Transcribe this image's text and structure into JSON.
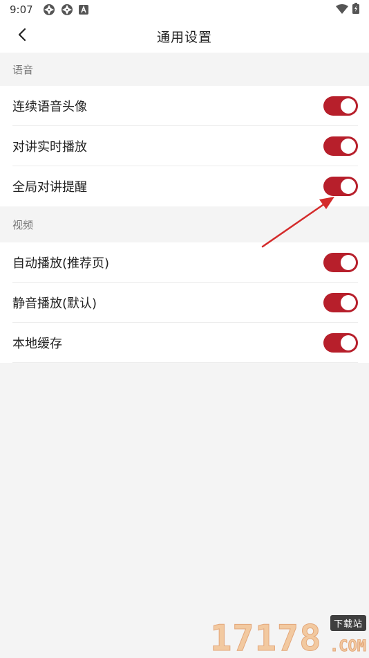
{
  "status_bar": {
    "time": "9:07",
    "icons_left": [
      "aperture-icon",
      "aperture-icon",
      "a-box-icon"
    ],
    "icons_right": [
      "wifi-icon",
      "battery-charging-icon"
    ]
  },
  "header": {
    "back_icon": "chevron-left-icon",
    "title": "通用设置"
  },
  "sections": [
    {
      "title": "语音",
      "items": [
        {
          "label": "连续语音头像",
          "enabled": true
        },
        {
          "label": "对讲实时播放",
          "enabled": true
        },
        {
          "label": "全局对讲提醒",
          "enabled": true
        }
      ]
    },
    {
      "title": "视频",
      "items": [
        {
          "label": "自动播放(推荐页)",
          "enabled": true
        },
        {
          "label": "静音播放(默认)",
          "enabled": true
        },
        {
          "label": "本地缓存",
          "enabled": true
        }
      ]
    }
  ],
  "annotation": {
    "type": "arrow",
    "color": "#d42b2b",
    "points_to": "全局对讲提醒 toggle"
  },
  "watermark": {
    "digits": "17178",
    "tag": "下载站",
    "domain": ".COM"
  },
  "colors": {
    "toggle_on": "#b71f2b",
    "background": "#f4f4f4",
    "surface": "#ffffff"
  }
}
